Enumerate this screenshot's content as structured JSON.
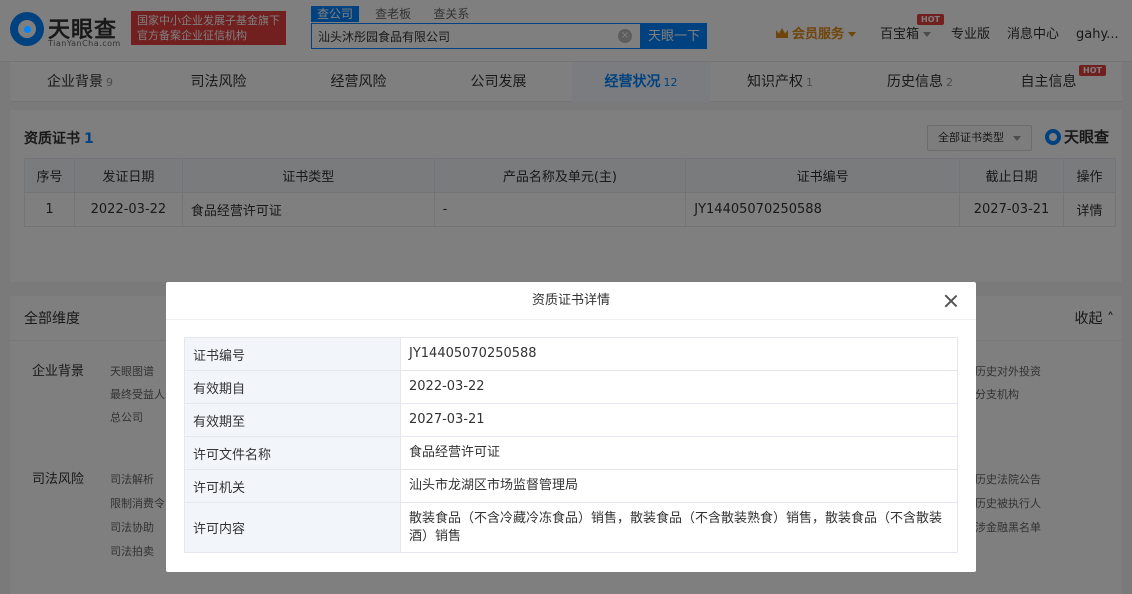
{
  "header": {
    "logo_text": "天眼查",
    "logo_sub": "TianYanCha.com",
    "slogan_line1": "国家中小企业发展子基金旗下",
    "slogan_line2": "官方备案企业征信机构",
    "search_tabs": [
      "查公司",
      "查老板",
      "查关系"
    ],
    "search_value": "汕头沐彤园食品有限公司",
    "clear_glyph": "×",
    "search_button": "天眼一下",
    "vip": "会员服务",
    "treasure": "百宝箱",
    "hot_badge": "HOT",
    "pro": "专业版",
    "messages": "消息中心",
    "user": "gahy..."
  },
  "tabs": [
    {
      "label": "企业背景",
      "count": "9"
    },
    {
      "label": "司法风险",
      "count": ""
    },
    {
      "label": "经营风险",
      "count": ""
    },
    {
      "label": "公司发展",
      "count": ""
    },
    {
      "label": "经营状况",
      "count": "12"
    },
    {
      "label": "知识产权",
      "count": "1"
    },
    {
      "label": "历史信息",
      "count": "2"
    },
    {
      "label": "自主信息",
      "count": ""
    }
  ],
  "cert_section": {
    "title": "资质证书",
    "count": "1",
    "filter": "全部证书类型",
    "brand": "天眼查",
    "columns": [
      "序号",
      "发证日期",
      "证书类型",
      "产品名称及单元(主)",
      "证书编号",
      "截止日期",
      "操作"
    ],
    "rows": [
      {
        "index": "1",
        "issue_date": "2022-03-22",
        "type": "食品经营许可证",
        "product": "-",
        "number": "JY14405070250588",
        "expire": "2027-03-21",
        "action": "详情"
      }
    ]
  },
  "dimensions": {
    "title": "全部维度",
    "collapse": "收起",
    "groups": [
      {
        "label": "企业背景",
        "items_left": [
          "天眼图谱",
          "最终受益人",
          "总公司"
        ],
        "items_right": [
          "历史对外投资",
          "分支机构"
        ]
      },
      {
        "label": "司法风险",
        "items_left": [
          "司法解析",
          "限制消费令",
          "司法协助",
          "司法拍卖"
        ],
        "items_right": [
          "历史法院公告",
          "历史被执行人",
          "涉金融黑名单"
        ]
      }
    ]
  },
  "modal": {
    "title": "资质证书详情",
    "rows": [
      {
        "key": "证书编号",
        "value": "JY14405070250588"
      },
      {
        "key": "有效期自",
        "value": "2022-03-22"
      },
      {
        "key": "有效期至",
        "value": "2027-03-21"
      },
      {
        "key": "许可文件名称",
        "value": "食品经营许可证"
      },
      {
        "key": "许可机关",
        "value": "汕头市龙湖区市场监督管理局"
      },
      {
        "key": "许可内容",
        "value": "散装食品（不含冷藏冷冻食品）销售，散装食品（不含散装熟食）销售，散装食品（不含散装酒）销售"
      }
    ]
  }
}
